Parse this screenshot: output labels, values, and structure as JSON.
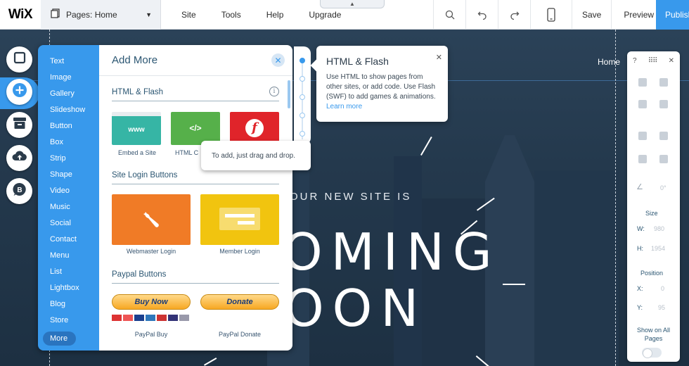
{
  "topbar": {
    "logo": "WiX",
    "pages_label": "Pages: Home",
    "menu": [
      "Site",
      "Tools",
      "Help",
      "Upgrade"
    ],
    "save": "Save",
    "preview": "Preview",
    "publish": "Publish"
  },
  "site": {
    "nav_home": "Home",
    "subtitle": "OUR NEW SITE IS",
    "headline_line1": "OMING",
    "headline_line2": "OON"
  },
  "add_panel": {
    "categories": [
      "Text",
      "Image",
      "Gallery",
      "Slideshow",
      "Button",
      "Box",
      "Strip",
      "Shape",
      "Video",
      "Music",
      "Social",
      "Contact",
      "Menu",
      "List",
      "Lightbox",
      "Blog",
      "Store",
      "More"
    ],
    "title": "Add More",
    "sections": {
      "html_flash": "HTML & Flash",
      "site_login": "Site Login Buttons",
      "paypal": "Paypal Buttons"
    },
    "items": {
      "embed_site": {
        "caption": "Embed a Site",
        "thumb_text": "www"
      },
      "html_code": {
        "caption": "HTML C",
        "thumb_text": "</>"
      },
      "webmaster_login": "Webmaster Login",
      "member_login": "Member Login",
      "paypal_buy": {
        "caption": "PayPal Buy",
        "button": "Buy Now"
      },
      "paypal_donate": {
        "caption": "PayPal Donate",
        "button": "Donate"
      }
    }
  },
  "help_popup": {
    "title": "HTML & Flash",
    "body": "Use HTML to show pages from other sites, or add code. Use Flash (SWF) to add games & animations.",
    "link": "Learn more"
  },
  "tooltip": "To add, just drag and drop.",
  "inspector": {
    "help": "?",
    "angle": "0°",
    "size_label": "Size",
    "w_label": "W:",
    "w_value": "980",
    "h_label": "H:",
    "h_value": "1954",
    "position_label": "Position",
    "x_label": "X:",
    "x_value": "0",
    "y_label": "Y:",
    "y_value": "95",
    "show_all_pages": "Show on All Pages"
  },
  "colors": {
    "accent": "#3899ec",
    "accent_dark": "#2a74bf",
    "www_thumb": "#36b5a5",
    "code_thumb": "#56b04a",
    "flash_thumb": "#e0242a",
    "webmaster": "#f07b26",
    "member": "#f1c40f"
  }
}
